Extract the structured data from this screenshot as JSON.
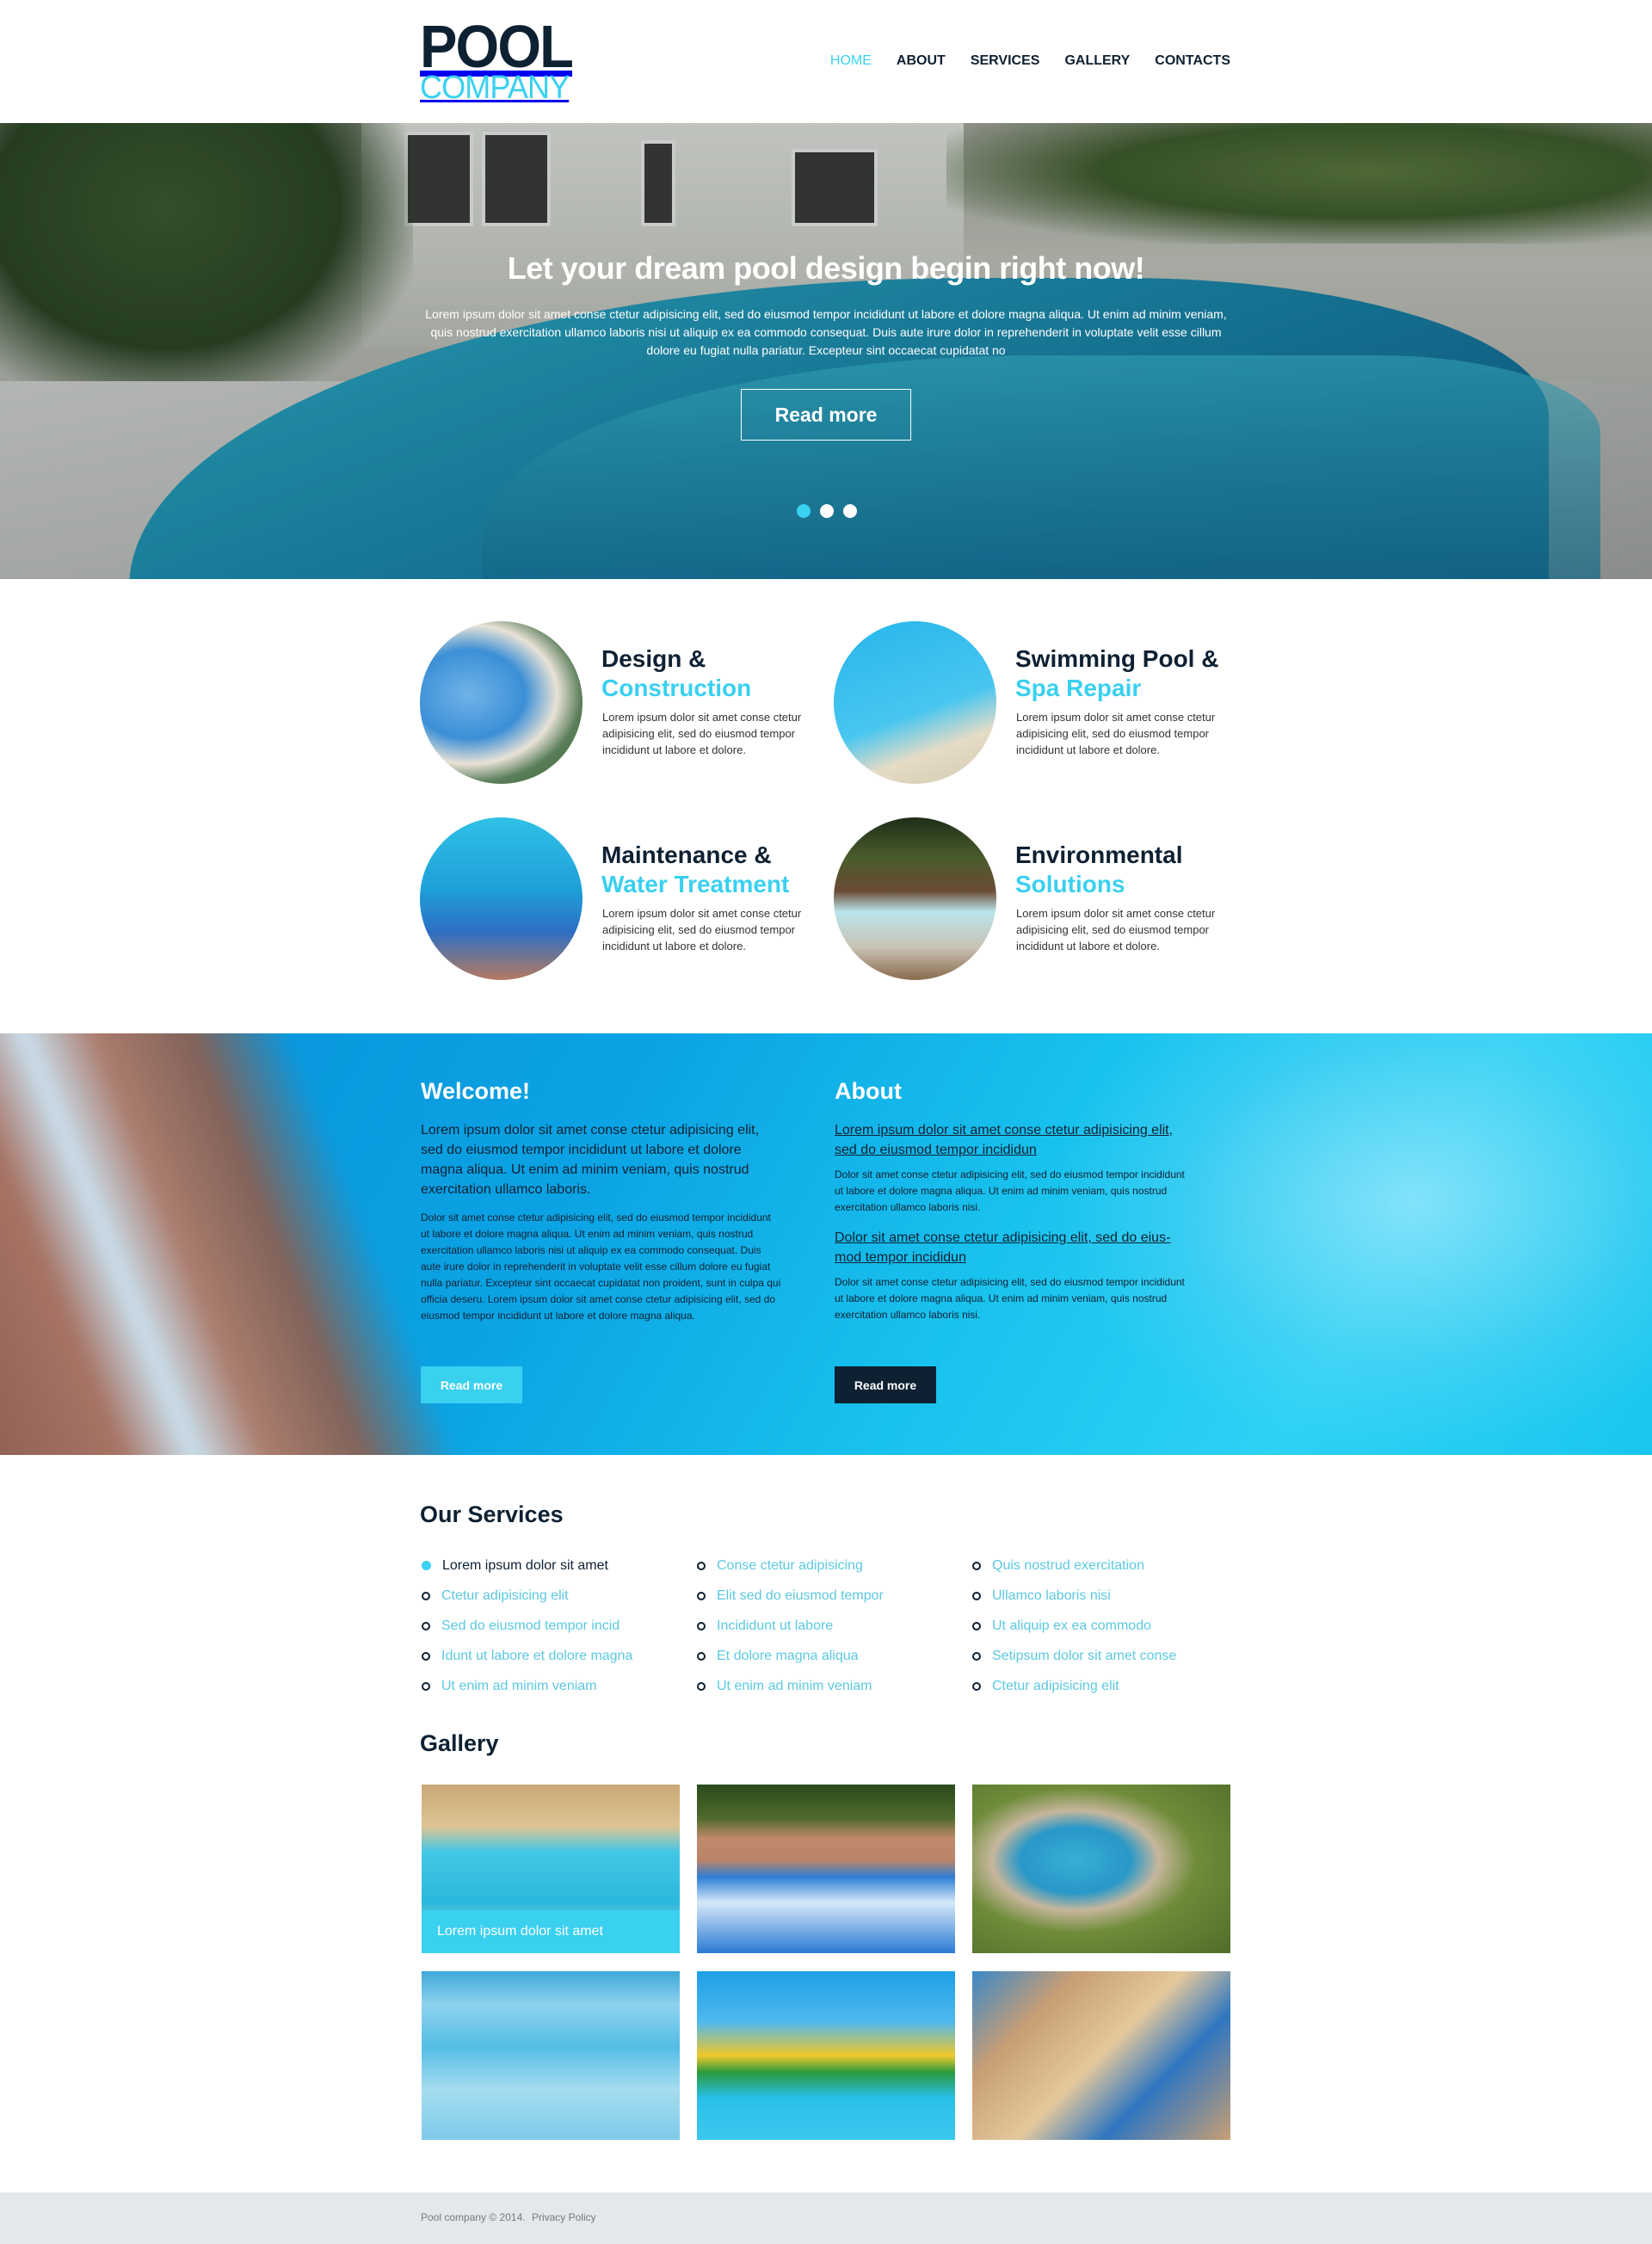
{
  "header": {
    "logo_top": "POOL",
    "logo_bottom": "COMPANY",
    "nav": [
      {
        "label": "HOME",
        "active": true
      },
      {
        "label": "ABOUT",
        "active": false
      },
      {
        "label": "SERVICES",
        "active": false
      },
      {
        "label": "GALLERY",
        "active": false
      },
      {
        "label": "CONTACTS",
        "active": false
      }
    ]
  },
  "hero": {
    "title": "Let your dream pool design begin right now!",
    "text": "Lorem ipsum dolor sit amet conse ctetur adipisicing elit, sed do eiusmod tempor incididunt ut labore et dolore magna aliqua. Ut enim ad minim veniam, quis nostrud exercitation ullamco laboris nisi ut aliquip ex ea commodo consequat. Duis aute irure dolor in reprehenderit in voluptate velit esse cillum dolore eu fugiat nulla pariatur. Excepteur sint occaecat cupidatat no",
    "button": "Read more",
    "slides": 3,
    "active_slide": 1
  },
  "features": [
    {
      "line1": "Design &",
      "line2": "Construction",
      "desc": "Lorem ipsum dolor sit amet conse ctetur adipisicing elit, sed do eiusmod tempor incididunt ut labore et dolore."
    },
    {
      "line1": "Swimming Pool &",
      "line2": "Spa Repair",
      "desc": "Lorem ipsum dolor sit amet conse ctetur adipisicing elit, sed do eiusmod tempor incididunt ut labore et dolore."
    },
    {
      "line1": "Maintenance &",
      "line2": "Water Treatment",
      "desc": "Lorem ipsum dolor sit amet conse ctetur adipisicing elit, sed do eiusmod tempor incididunt ut labore et dolore."
    },
    {
      "line1": "Environmental",
      "line2": "Solutions",
      "desc": "Lorem ipsum dolor sit amet conse ctetur adipisicing elit, sed do eiusmod tempor incididunt ut labore et dolore."
    }
  ],
  "welcome": {
    "title": "Welcome!",
    "lead": "Lorem ipsum dolor sit amet conse ctetur adipisicing elit, sed do eiusmod tempor incididunt ut labore et dolore magna aliqua. Ut enim ad minim veniam, quis nostrud exercitation ullamco laboris.",
    "body": "Dolor sit amet conse ctetur adipisicing elit, sed do eiusmod tempor incididunt ut labore et dolore magna aliqua. Ut enim ad minim veniam, quis nostrud exercitation ullamco laboris nisi ut aliquip ex ea commodo consequat. Duis aute irure dolor in reprehenderit in voluptate velit esse cillum dolore eu fugiat nulla pariatur. Excepteur sint occaecat cupidatat non proident, sunt in culpa qui officia deseru. Lorem ipsum dolor sit amet conse ctetur adipisicing elit, sed do eiusmod tempor incididunt ut labore et dolore magna aliqua.",
    "button": "Read more"
  },
  "about": {
    "title": "About",
    "link1": "Lorem ipsum dolor sit amet conse ctetur adipisicing elit, sed do eiusmod tempor incididun",
    "body1": "Dolor sit amet conse ctetur adipisicing elit, sed do eiusmod tempor incididunt ut labore et dolore magna aliqua. Ut enim ad minim veniam, quis nostrud exercitation ullamco laboris nisi.",
    "link2": "Dolor sit amet conse ctetur adipisicing elit, sed do eius-mod tempor incididun",
    "body2": "Dolor sit amet conse ctetur adipisicing elit, sed do eiusmod tempor incididunt ut labore et dolore magna aliqua. Ut enim ad minim veniam, quis nostrud exercitation ullamco laboris nisi.",
    "button": "Read more"
  },
  "services": {
    "title": "Our Services",
    "columns": [
      [
        {
          "label": "Lorem ipsum dolor sit amet",
          "active": true
        },
        {
          "label": "Ctetur adipisicing elit",
          "active": false
        },
        {
          "label": "Sed do eiusmod tempor incid",
          "active": false
        },
        {
          "label": "Idunt ut labore et dolore magna",
          "active": false
        },
        {
          "label": "Ut enim ad minim veniam",
          "active": false
        }
      ],
      [
        {
          "label": "Conse ctetur adipisicing",
          "active": false
        },
        {
          "label": "Elit sed do eiusmod tempor",
          "active": false
        },
        {
          "label": "Incididunt ut labore",
          "active": false
        },
        {
          "label": "Et dolore magna aliqua",
          "active": false
        },
        {
          "label": "Ut enim ad minim veniam",
          "active": false
        }
      ],
      [
        {
          "label": "Quis nostrud exercitation",
          "active": false
        },
        {
          "label": "Ullamco laboris nisi",
          "active": false
        },
        {
          "label": "Ut aliquip ex ea commodo",
          "active": false
        },
        {
          "label": "Setipsum dolor sit amet conse",
          "active": false
        },
        {
          "label": "Ctetur adipisicing elit",
          "active": false
        }
      ]
    ]
  },
  "gallery": {
    "title": "Gallery",
    "caption": "Lorem ipsum dolor sit amet",
    "items": [
      "indoor-pool",
      "pool-with-loungers",
      "garden-pool-aerial",
      "tiled-indoor-pool",
      "water-park-slides",
      "hotel-pool"
    ]
  },
  "footer": {
    "copyright": "Pool company © 2014.",
    "privacy": "Privacy Policy"
  },
  "colors": {
    "accent": "#3ad0f0",
    "dark": "#0e2132",
    "footer_bg": "#e4e8ea"
  }
}
